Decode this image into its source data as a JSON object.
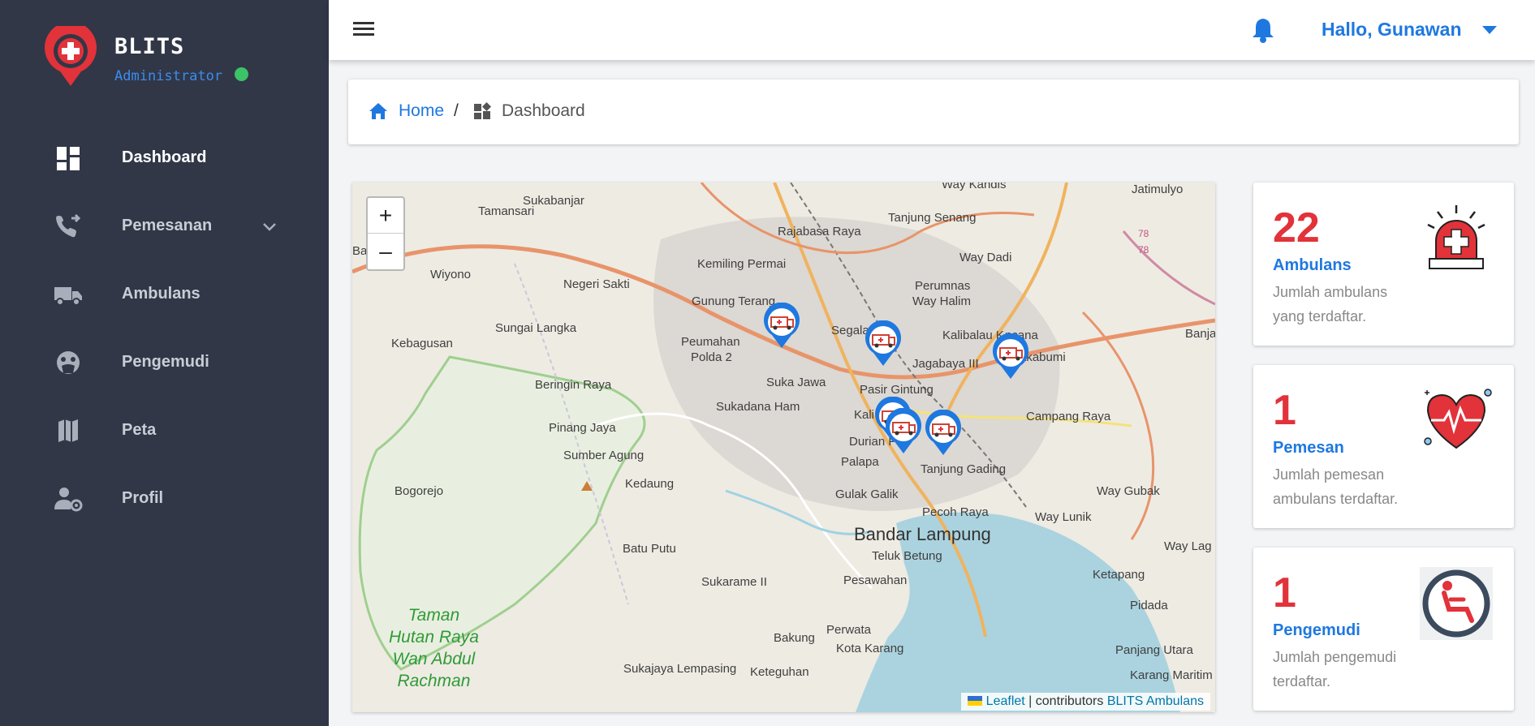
{
  "brand": {
    "name": "BLITS",
    "role": "Administrator"
  },
  "sidebar": {
    "items": [
      {
        "label": "Dashboard",
        "icon": "dashboard-icon",
        "active": true
      },
      {
        "label": "Pemesanan",
        "icon": "phone-forward-icon",
        "active": false,
        "expandable": true
      },
      {
        "label": "Ambulans",
        "icon": "truck-icon",
        "active": false
      },
      {
        "label": "Pengemudi",
        "icon": "face-icon",
        "active": false
      },
      {
        "label": "Peta",
        "icon": "map-icon",
        "active": false
      },
      {
        "label": "Profil",
        "icon": "user-cog-icon",
        "active": false
      }
    ]
  },
  "header": {
    "greeting": "Hallo, Gunawan"
  },
  "breadcrumb": {
    "home": "Home",
    "separator": "/",
    "current": "Dashboard"
  },
  "map": {
    "zoom_in": "+",
    "zoom_out": "–",
    "attribution": {
      "leaflet": "Leaflet",
      "sep": "| contributors",
      "source": "BLITS Ambulans"
    },
    "labels": {
      "tamansari": "Tamansari",
      "rajabasa_raya": "Rajabasa Raya",
      "tanjung_senang": "Tanjung Senang",
      "jatimulyo": "Jatimulyo",
      "way_kandis": "Way Kandis",
      "wiyono": "Wiyono",
      "negeri_sakti": "Negeri Sakti",
      "kemiling_permai": "Kemiling Permai",
      "way_dadi": "Way Dadi",
      "perumnas": "Perumnas",
      "gunung_terang": "Gunung Terang",
      "way_halim": "Way Halim",
      "sungai_langka": "Sungai Langka",
      "segala_mider": "Segala",
      "kalibalau_kencana": "Kalibalau K",
      "kencana_tail": "ncana",
      "banjar": "Banjar",
      "kebagusan": "Kebagusan",
      "peumahan": "Peumahan",
      "polda2": "Polda 2",
      "sukabumi": "akabumi",
      "jagabaya": "Jagabaya III",
      "suka_jawa": "Suka Jawa",
      "beringin_raya": "Beringin Raya",
      "pasir_gintung": "Pasir Gintung",
      "sukadana_ham": "Sukadana Ham",
      "kali": "Kali",
      "campang_raya": "Campang Raya",
      "pinang_jaya": "Pinang Jaya",
      "durian_payung": "Durian P",
      "palapa": "Palapa",
      "sumber_agung": "Sumber Agung",
      "tanjung_gading": "Tanjung Gading",
      "kedaung": "Kedaung",
      "bogorejo": "Bogorejo",
      "way_gubak": "Way Gubak",
      "gulak_galik": "Gulak Galik",
      "pecoh_raya": "Pecoh Raya",
      "way_lunik": "Way Lunik",
      "bandar_lampung": "Bandar Lampung",
      "way_lag": "Way Lag",
      "batu_putu": "Batu Putu",
      "teluk_betung": "Teluk Betung",
      "ketapang": "Ketapang",
      "sukarame_ii": "Sukarame II",
      "pesawahan": "Pesawahan",
      "pidada": "Pidada",
      "taman_hutan": "Taman\nHutan Raya\nWan Abdul\nRachman",
      "perwata": "Perwata",
      "bakung": "Bakung",
      "kota_karang": "Kota Karang",
      "panjang_utara": "Panjang Utara",
      "sukajaya": "Sukajaya Lempasing",
      "keteguhan": "Keteguhan",
      "karang_maritim": "Karang Maritim",
      "bag": "Bag",
      "r78a": "78",
      "r78b": "78",
      "sukabanjar": "Sukabanjar"
    }
  },
  "stats": [
    {
      "value": "22",
      "title": "Ambulans",
      "desc": "Jumlah ambulans yang terdaftar.",
      "icon": "siren-icon"
    },
    {
      "value": "1",
      "title": "Pemesan",
      "desc": "Jumlah pemesan ambulans terdaftar.",
      "icon": "heartbeat-icon"
    },
    {
      "value": "1",
      "title": "Pengemudi",
      "desc": "Jumlah pengemudi terdaftar.",
      "icon": "driver-seat-icon"
    }
  ],
  "colors": {
    "sidebar_bg": "#313747",
    "accent_blue": "#1e78e0",
    "accent_red": "#e2323a",
    "online": "#3cc267"
  }
}
